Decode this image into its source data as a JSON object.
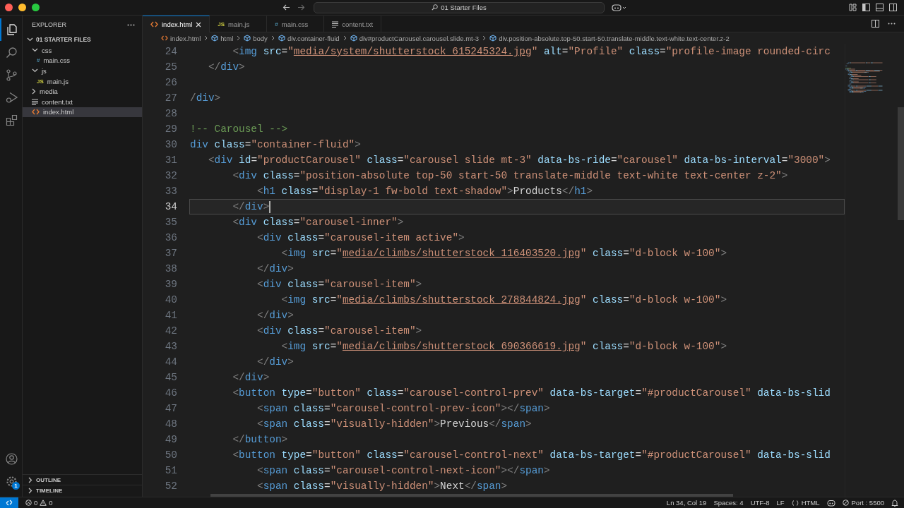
{
  "window": {
    "search": "01 Starter Files"
  },
  "activity_bar": [
    {
      "kind": "explorer",
      "selected": true
    },
    {
      "kind": "search",
      "selected": false
    },
    {
      "kind": "source-control",
      "selected": false
    },
    {
      "kind": "run-debug",
      "selected": false
    },
    {
      "kind": "extensions",
      "selected": false
    }
  ],
  "activity_bottom": {
    "settings_badge": "1"
  },
  "sidebar": {
    "title": "EXPLORER",
    "tree": {
      "label": "01 STARTER FILES",
      "expanded": true,
      "children": [
        {
          "label": "css",
          "kind": "folder",
          "expanded": true,
          "selected": false,
          "children": [
            {
              "label": "main.css",
              "kind": "css",
              "glyph": "#",
              "selected": false
            }
          ]
        },
        {
          "label": "js",
          "kind": "folder",
          "expanded": true,
          "selected": false,
          "children": [
            {
              "label": "main.js",
              "kind": "js",
              "glyph": "JS",
              "selected": false
            }
          ]
        },
        {
          "label": "media",
          "kind": "folder",
          "expanded": false,
          "selected": false
        },
        {
          "label": "content.txt",
          "kind": "txt",
          "selected": false
        },
        {
          "label": "index.html",
          "kind": "html",
          "selected": true
        }
      ]
    },
    "panels": [
      {
        "label": "OUTLINE",
        "expanded": false
      },
      {
        "label": "TIMELINE",
        "expanded": false
      }
    ]
  },
  "tabs": [
    {
      "label": "index.html",
      "kind": "html",
      "selected": true
    },
    {
      "label": "main.js",
      "kind": "js",
      "glyph": "JS",
      "selected": false
    },
    {
      "label": "main.css",
      "kind": "css",
      "glyph": "#",
      "selected": false
    },
    {
      "label": "content.txt",
      "kind": "txt",
      "selected": false
    }
  ],
  "breadcrumbs": [
    {
      "label": "index.html",
      "kind": "html"
    },
    {
      "label": "html",
      "kind": "element"
    },
    {
      "label": "body",
      "kind": "element"
    },
    {
      "label": "div.container-fluid",
      "kind": "element"
    },
    {
      "label": "div#productCarousel.carousel.slide.mt-3",
      "kind": "element"
    },
    {
      "label": "div.position-absolute.top-50.start-50.translate-middle.text-white.text-center.z-2",
      "kind": "element"
    }
  ],
  "editor": {
    "lines": [
      {
        "number": "24",
        "current": false,
        "tokens": [
          {
            "kind": "punct",
            "text": "       <"
          },
          {
            "kind": "tag",
            "text": "img"
          },
          {
            "kind": "attr",
            "text": " src"
          },
          {
            "kind": "plain",
            "text": "="
          },
          {
            "kind": "string",
            "text": "\""
          },
          {
            "kind": "link",
            "text": "media/system/shutterstock_615245324.jpg"
          },
          {
            "kind": "string",
            "text": "\""
          },
          {
            "kind": "attr",
            "text": " alt"
          },
          {
            "kind": "plain",
            "text": "="
          },
          {
            "kind": "string",
            "text": "\"Profile\""
          },
          {
            "kind": "attr",
            "text": " class"
          },
          {
            "kind": "plain",
            "text": "="
          },
          {
            "kind": "string",
            "text": "\"profile-image rounded-circ"
          }
        ]
      },
      {
        "number": "25",
        "current": false,
        "tokens": [
          {
            "kind": "punct",
            "text": "   </"
          },
          {
            "kind": "tag",
            "text": "div"
          },
          {
            "kind": "punct",
            "text": ">"
          }
        ]
      },
      {
        "number": "26",
        "current": false
      },
      {
        "number": "27",
        "current": false,
        "tokens": [
          {
            "kind": "punct",
            "text": "/"
          },
          {
            "kind": "tag",
            "text": "div"
          },
          {
            "kind": "punct",
            "text": ">"
          }
        ]
      },
      {
        "number": "28",
        "current": false
      },
      {
        "number": "29",
        "current": false,
        "tokens": [
          {
            "kind": "comment",
            "text": "!-- Carousel -->"
          }
        ]
      },
      {
        "number": "30",
        "current": false,
        "tokens": [
          {
            "kind": "tag",
            "text": "div"
          },
          {
            "kind": "attr",
            "text": " class"
          },
          {
            "kind": "plain",
            "text": "="
          },
          {
            "kind": "string",
            "text": "\"container-fluid\""
          },
          {
            "kind": "punct",
            "text": ">"
          }
        ]
      },
      {
        "number": "31",
        "current": false,
        "tokens": [
          {
            "kind": "punct",
            "text": "   <"
          },
          {
            "kind": "tag",
            "text": "div"
          },
          {
            "kind": "attr",
            "text": " id"
          },
          {
            "kind": "plain",
            "text": "="
          },
          {
            "kind": "string",
            "text": "\"productCarousel\""
          },
          {
            "kind": "attr",
            "text": " class"
          },
          {
            "kind": "plain",
            "text": "="
          },
          {
            "kind": "string",
            "text": "\"carousel slide mt-3\""
          },
          {
            "kind": "attr",
            "text": " data-bs-ride"
          },
          {
            "kind": "plain",
            "text": "="
          },
          {
            "kind": "string",
            "text": "\"carousel\""
          },
          {
            "kind": "attr",
            "text": " data-bs-interval"
          },
          {
            "kind": "plain",
            "text": "="
          },
          {
            "kind": "string",
            "text": "\"3000\""
          },
          {
            "kind": "punct",
            "text": ">"
          }
        ]
      },
      {
        "number": "32",
        "current": false,
        "tokens": [
          {
            "kind": "punct",
            "text": "       <"
          },
          {
            "kind": "tag",
            "text": "div"
          },
          {
            "kind": "attr",
            "text": " class"
          },
          {
            "kind": "plain",
            "text": "="
          },
          {
            "kind": "string",
            "text": "\"position-absolute top-50 start-50 translate-middle text-white text-center z-2\""
          },
          {
            "kind": "punct",
            "text": ">"
          }
        ]
      },
      {
        "number": "33",
        "current": false,
        "tokens": [
          {
            "kind": "punct",
            "text": "           <"
          },
          {
            "kind": "tag",
            "text": "h1"
          },
          {
            "kind": "attr",
            "text": " class"
          },
          {
            "kind": "plain",
            "text": "="
          },
          {
            "kind": "string",
            "text": "\"display-1 fw-bold text-shadow\""
          },
          {
            "kind": "punct",
            "text": ">"
          },
          {
            "kind": "plain",
            "text": "Products"
          },
          {
            "kind": "punct",
            "text": "</"
          },
          {
            "kind": "tag",
            "text": "h1"
          },
          {
            "kind": "punct",
            "text": ">"
          }
        ]
      },
      {
        "number": "34",
        "current": true,
        "tokens": [
          {
            "kind": "punct",
            "text": "       </"
          },
          {
            "kind": "tag",
            "text": "div"
          },
          {
            "kind": "punct",
            "text": ">"
          }
        ]
      },
      {
        "number": "35",
        "current": false,
        "tokens": [
          {
            "kind": "punct",
            "text": "       <"
          },
          {
            "kind": "tag",
            "text": "div"
          },
          {
            "kind": "attr",
            "text": " class"
          },
          {
            "kind": "plain",
            "text": "="
          },
          {
            "kind": "string",
            "text": "\"carousel-inner\""
          },
          {
            "kind": "punct",
            "text": ">"
          }
        ]
      },
      {
        "number": "36",
        "current": false,
        "tokens": [
          {
            "kind": "punct",
            "text": "           <"
          },
          {
            "kind": "tag",
            "text": "div"
          },
          {
            "kind": "attr",
            "text": " class"
          },
          {
            "kind": "plain",
            "text": "="
          },
          {
            "kind": "string",
            "text": "\"carousel-item active\""
          },
          {
            "kind": "punct",
            "text": ">"
          }
        ]
      },
      {
        "number": "37",
        "current": false,
        "tokens": [
          {
            "kind": "punct",
            "text": "               <"
          },
          {
            "kind": "tag",
            "text": "img"
          },
          {
            "kind": "attr",
            "text": " src"
          },
          {
            "kind": "plain",
            "text": "="
          },
          {
            "kind": "string",
            "text": "\""
          },
          {
            "kind": "link",
            "text": "media/climbs/shutterstock_116403520.jpg"
          },
          {
            "kind": "string",
            "text": "\""
          },
          {
            "kind": "attr",
            "text": " class"
          },
          {
            "kind": "plain",
            "text": "="
          },
          {
            "kind": "string",
            "text": "\"d-block w-100\""
          },
          {
            "kind": "punct",
            "text": ">"
          }
        ]
      },
      {
        "number": "38",
        "current": false,
        "tokens": [
          {
            "kind": "punct",
            "text": "           </"
          },
          {
            "kind": "tag",
            "text": "div"
          },
          {
            "kind": "punct",
            "text": ">"
          }
        ]
      },
      {
        "number": "39",
        "current": false,
        "tokens": [
          {
            "kind": "punct",
            "text": "           <"
          },
          {
            "kind": "tag",
            "text": "div"
          },
          {
            "kind": "attr",
            "text": " class"
          },
          {
            "kind": "plain",
            "text": "="
          },
          {
            "kind": "string",
            "text": "\"carousel-item\""
          },
          {
            "kind": "punct",
            "text": ">"
          }
        ]
      },
      {
        "number": "40",
        "current": false,
        "tokens": [
          {
            "kind": "punct",
            "text": "               <"
          },
          {
            "kind": "tag",
            "text": "img"
          },
          {
            "kind": "attr",
            "text": " src"
          },
          {
            "kind": "plain",
            "text": "="
          },
          {
            "kind": "string",
            "text": "\""
          },
          {
            "kind": "link",
            "text": "media/climbs/shutterstock_278844824.jpg"
          },
          {
            "kind": "string",
            "text": "\""
          },
          {
            "kind": "attr",
            "text": " class"
          },
          {
            "kind": "plain",
            "text": "="
          },
          {
            "kind": "string",
            "text": "\"d-block w-100\""
          },
          {
            "kind": "punct",
            "text": ">"
          }
        ]
      },
      {
        "number": "41",
        "current": false,
        "tokens": [
          {
            "kind": "punct",
            "text": "           </"
          },
          {
            "kind": "tag",
            "text": "div"
          },
          {
            "kind": "punct",
            "text": ">"
          }
        ]
      },
      {
        "number": "42",
        "current": false,
        "tokens": [
          {
            "kind": "punct",
            "text": "           <"
          },
          {
            "kind": "tag",
            "text": "div"
          },
          {
            "kind": "attr",
            "text": " class"
          },
          {
            "kind": "plain",
            "text": "="
          },
          {
            "kind": "string",
            "text": "\"carousel-item\""
          },
          {
            "kind": "punct",
            "text": ">"
          }
        ]
      },
      {
        "number": "43",
        "current": false,
        "tokens": [
          {
            "kind": "punct",
            "text": "               <"
          },
          {
            "kind": "tag",
            "text": "img"
          },
          {
            "kind": "attr",
            "text": " src"
          },
          {
            "kind": "plain",
            "text": "="
          },
          {
            "kind": "string",
            "text": "\""
          },
          {
            "kind": "link",
            "text": "media/climbs/shutterstock_690366619.jpg"
          },
          {
            "kind": "string",
            "text": "\""
          },
          {
            "kind": "attr",
            "text": " class"
          },
          {
            "kind": "plain",
            "text": "="
          },
          {
            "kind": "string",
            "text": "\"d-block w-100\""
          },
          {
            "kind": "punct",
            "text": ">"
          }
        ]
      },
      {
        "number": "44",
        "current": false,
        "tokens": [
          {
            "kind": "punct",
            "text": "           </"
          },
          {
            "kind": "tag",
            "text": "div"
          },
          {
            "kind": "punct",
            "text": ">"
          }
        ]
      },
      {
        "number": "45",
        "current": false,
        "tokens": [
          {
            "kind": "punct",
            "text": "       </"
          },
          {
            "kind": "tag",
            "text": "div"
          },
          {
            "kind": "punct",
            "text": ">"
          }
        ]
      },
      {
        "number": "46",
        "current": false,
        "tokens": [
          {
            "kind": "punct",
            "text": "       <"
          },
          {
            "kind": "tag",
            "text": "button"
          },
          {
            "kind": "attr",
            "text": " type"
          },
          {
            "kind": "plain",
            "text": "="
          },
          {
            "kind": "string",
            "text": "\"button\""
          },
          {
            "kind": "attr",
            "text": " class"
          },
          {
            "kind": "plain",
            "text": "="
          },
          {
            "kind": "string",
            "text": "\"carousel-control-prev\""
          },
          {
            "kind": "attr",
            "text": " data-bs-target"
          },
          {
            "kind": "plain",
            "text": "="
          },
          {
            "kind": "string",
            "text": "\"#productCarousel\""
          },
          {
            "kind": "attr",
            "text": " data-bs-slid"
          }
        ]
      },
      {
        "number": "47",
        "current": false,
        "tokens": [
          {
            "kind": "punct",
            "text": "           <"
          },
          {
            "kind": "tag",
            "text": "span"
          },
          {
            "kind": "attr",
            "text": " class"
          },
          {
            "kind": "plain",
            "text": "="
          },
          {
            "kind": "string",
            "text": "\"carousel-control-prev-icon\""
          },
          {
            "kind": "punct",
            "text": "></"
          },
          {
            "kind": "tag",
            "text": "span"
          },
          {
            "kind": "punct",
            "text": ">"
          }
        ]
      },
      {
        "number": "48",
        "current": false,
        "tokens": [
          {
            "kind": "punct",
            "text": "           <"
          },
          {
            "kind": "tag",
            "text": "span"
          },
          {
            "kind": "attr",
            "text": " class"
          },
          {
            "kind": "plain",
            "text": "="
          },
          {
            "kind": "string",
            "text": "\"visually-hidden\""
          },
          {
            "kind": "punct",
            "text": ">"
          },
          {
            "kind": "plain",
            "text": "Previous"
          },
          {
            "kind": "punct",
            "text": "</"
          },
          {
            "kind": "tag",
            "text": "span"
          },
          {
            "kind": "punct",
            "text": ">"
          }
        ]
      },
      {
        "number": "49",
        "current": false,
        "tokens": [
          {
            "kind": "punct",
            "text": "       </"
          },
          {
            "kind": "tag",
            "text": "button"
          },
          {
            "kind": "punct",
            "text": ">"
          }
        ]
      },
      {
        "number": "50",
        "current": false,
        "tokens": [
          {
            "kind": "punct",
            "text": "       <"
          },
          {
            "kind": "tag",
            "text": "button"
          },
          {
            "kind": "attr",
            "text": " type"
          },
          {
            "kind": "plain",
            "text": "="
          },
          {
            "kind": "string",
            "text": "\"button\""
          },
          {
            "kind": "attr",
            "text": " class"
          },
          {
            "kind": "plain",
            "text": "="
          },
          {
            "kind": "string",
            "text": "\"carousel-control-next\""
          },
          {
            "kind": "attr",
            "text": " data-bs-target"
          },
          {
            "kind": "plain",
            "text": "="
          },
          {
            "kind": "string",
            "text": "\"#productCarousel\""
          },
          {
            "kind": "attr",
            "text": " data-bs-slid"
          }
        ]
      },
      {
        "number": "51",
        "current": false,
        "tokens": [
          {
            "kind": "punct",
            "text": "           <"
          },
          {
            "kind": "tag",
            "text": "span"
          },
          {
            "kind": "attr",
            "text": " class"
          },
          {
            "kind": "plain",
            "text": "="
          },
          {
            "kind": "string",
            "text": "\"carousel-control-next-icon\""
          },
          {
            "kind": "punct",
            "text": "></"
          },
          {
            "kind": "tag",
            "text": "span"
          },
          {
            "kind": "punct",
            "text": ">"
          }
        ]
      },
      {
        "number": "52",
        "current": false,
        "tokens": [
          {
            "kind": "punct",
            "text": "           <"
          },
          {
            "kind": "tag",
            "text": "span"
          },
          {
            "kind": "attr",
            "text": " class"
          },
          {
            "kind": "plain",
            "text": "="
          },
          {
            "kind": "string",
            "text": "\"visually-hidden\""
          },
          {
            "kind": "punct",
            "text": ">"
          },
          {
            "kind": "plain",
            "text": "Next"
          },
          {
            "kind": "punct",
            "text": "</"
          },
          {
            "kind": "tag",
            "text": "span"
          },
          {
            "kind": "punct",
            "text": ">"
          }
        ]
      }
    ]
  },
  "status_bar": {
    "problems": [
      {
        "kind": "error",
        "count": "0"
      },
      {
        "kind": "warning",
        "count": "0"
      }
    ],
    "items": [
      {
        "kind": "text",
        "label": "Ln 34, Col 19"
      },
      {
        "kind": "text",
        "label": "Spaces: 4"
      },
      {
        "kind": "text",
        "label": "UTF-8"
      },
      {
        "kind": "text",
        "label": "LF"
      },
      {
        "kind": "language",
        "label": "HTML"
      },
      {
        "kind": "copilot"
      },
      {
        "kind": "port",
        "label": "Port : 5500"
      },
      {
        "kind": "notifications"
      }
    ]
  }
}
